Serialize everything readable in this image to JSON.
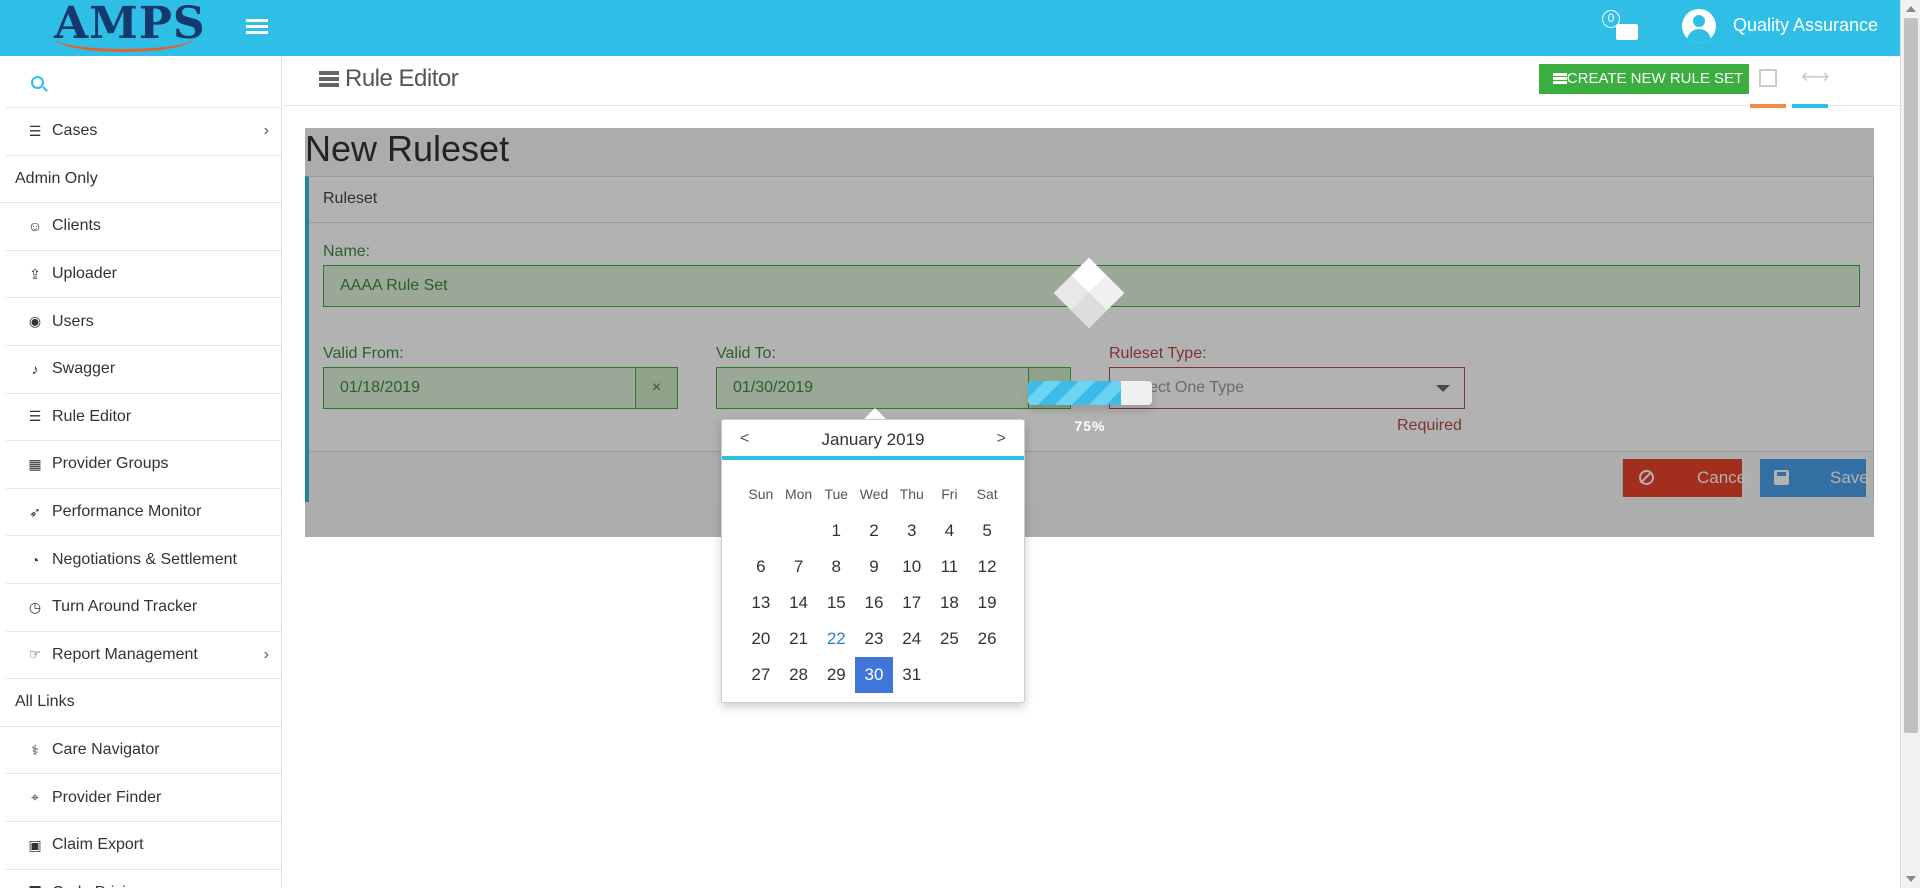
{
  "header": {
    "logo": "AMPS",
    "notification_count": "0",
    "user_name": "Quality Assurance"
  },
  "sidebar": {
    "items": [
      {
        "type": "item",
        "label": "Cases",
        "icon": "book-icon",
        "glyph": "☰",
        "chevron": true
      },
      {
        "type": "section",
        "label": "Admin Only"
      },
      {
        "type": "item",
        "label": "Clients",
        "icon": "users-icon",
        "glyph": "☺"
      },
      {
        "type": "item",
        "label": "Uploader",
        "icon": "upload-icon",
        "glyph": "⇪"
      },
      {
        "type": "item",
        "label": "Users",
        "icon": "user-circle-icon",
        "glyph": "◉"
      },
      {
        "type": "item",
        "label": "Swagger",
        "icon": "swagger-icon",
        "glyph": "♪"
      },
      {
        "type": "item",
        "label": "Rule Editor",
        "icon": "list-icon",
        "glyph": "☰"
      },
      {
        "type": "item",
        "label": "Provider Groups",
        "icon": "cubes-icon",
        "glyph": "▦"
      },
      {
        "type": "item",
        "label": "Performance Monitor",
        "icon": "rocket-icon",
        "glyph": "➶"
      },
      {
        "type": "item",
        "label": "Negotiations & Settlement",
        "icon": "dashboard-icon",
        "glyph": "◔"
      },
      {
        "type": "item",
        "label": "Turn Around Tracker",
        "icon": "clock-icon",
        "glyph": "◷"
      },
      {
        "type": "item",
        "label": "Report Management",
        "icon": "hand-point-icon",
        "glyph": "☞",
        "chevron": true
      },
      {
        "type": "section",
        "label": "All Links"
      },
      {
        "type": "item",
        "label": "Care Navigator",
        "icon": "stethoscope-icon",
        "glyph": "⚕"
      },
      {
        "type": "item",
        "label": "Provider Finder",
        "icon": "map-marker-icon",
        "glyph": "⌖"
      },
      {
        "type": "item",
        "label": "Claim Export",
        "icon": "floppy-icon",
        "glyph": "▣"
      },
      {
        "type": "item",
        "label": "Code Pricing",
        "icon": "bar-chart-icon",
        "glyph": "▇"
      }
    ]
  },
  "content_header": {
    "title": "Rule Editor",
    "create_button": "CREATE NEW RULE SET"
  },
  "form": {
    "page_title": "New Ruleset",
    "panel_title": "Ruleset",
    "name_label": "Name:",
    "name_value": "AAAA Rule Set",
    "valid_from_label": "Valid From:",
    "valid_from_value": "01/18/2019",
    "clear_glyph": "×",
    "valid_to_label": "Valid To:",
    "valid_to_value": "01/30/2019",
    "type_label": "Ruleset Type:",
    "type_placeholder": "Select One Type",
    "required_text": "Required",
    "cancel_label": "Cancel",
    "save_label": "Save"
  },
  "loader": {
    "progress_percent": 75,
    "progress_label": "75%"
  },
  "datepicker": {
    "prev": "<",
    "next": ">",
    "title": "January 2019",
    "weekdays": [
      "Sun",
      "Mon",
      "Tue",
      "Wed",
      "Thu",
      "Fri",
      "Sat"
    ],
    "first_weekday_index": 2,
    "days_in_month": 31,
    "today": 22,
    "selected": 30
  },
  "colors": {
    "primary": "#2fbfe6",
    "success": "#3aaf3f",
    "danger": "#e8432a",
    "info": "#4a9fe8",
    "selected_day": "#3f76d8"
  }
}
